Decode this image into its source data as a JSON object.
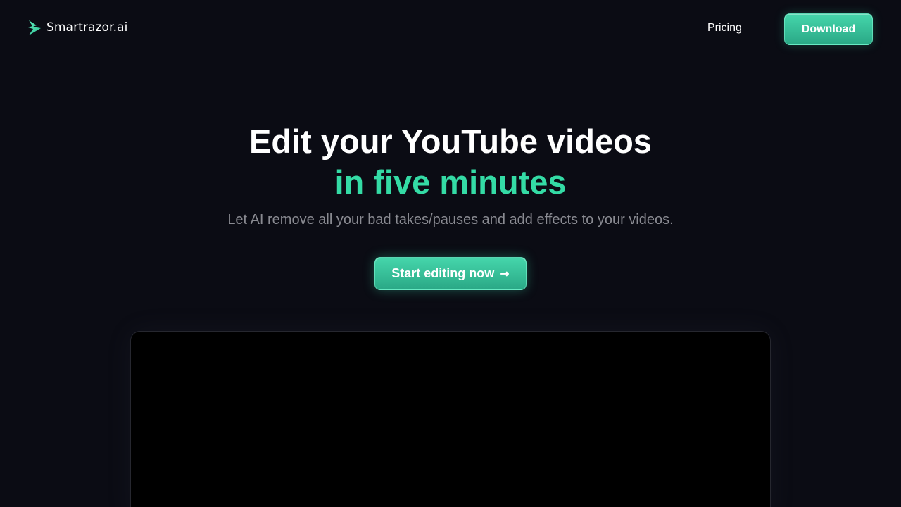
{
  "brand": {
    "name": "Smartrazor.ai",
    "icon": "lightning-bolt-icon"
  },
  "nav": {
    "pricing_label": "Pricing",
    "download_label": "Download"
  },
  "hero": {
    "title_line1": "Edit your YouTube videos",
    "title_line2": "in five minutes",
    "subtitle": "Let AI remove all your bad takes/pauses and add effects to your videos.",
    "cta_label": "Start editing now",
    "cta_arrow": "→"
  },
  "colors": {
    "background": "#0b0c14",
    "accent": "#34dba5",
    "button": "#3cc49c",
    "subtitle": "#8a8b92",
    "video_background": "#000000"
  }
}
